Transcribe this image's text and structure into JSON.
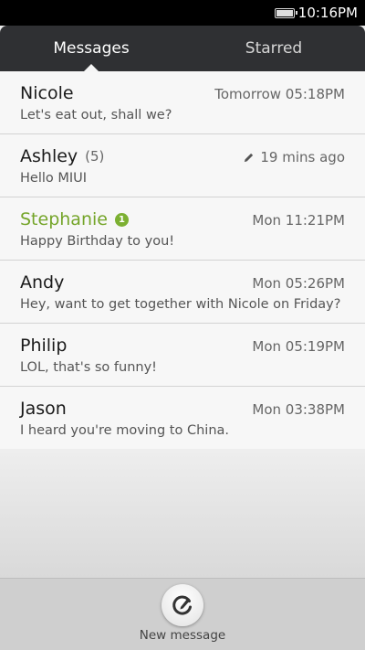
{
  "status_bar": {
    "time": "10:16PM",
    "battery_icon": "battery-icon",
    "battery_level": 1.0
  },
  "tabs": [
    {
      "label": "Messages",
      "active": true
    },
    {
      "label": "Starred",
      "active": false
    }
  ],
  "messages": [
    {
      "name": "Nicole",
      "count": "",
      "unread": "",
      "time": "Tomorrow 05:18PM",
      "snippet": "Let's eat out, shall we?",
      "draft": false
    },
    {
      "name": "Ashley",
      "count": "(5)",
      "unread": "",
      "time": "19 mins ago",
      "snippet": "Hello MIUI",
      "draft": true
    },
    {
      "name": "Stephanie",
      "count": "",
      "unread": "1",
      "time": "Mon 11:21PM",
      "snippet": "Happy Birthday to you!",
      "draft": false
    },
    {
      "name": "Andy",
      "count": "",
      "unread": "",
      "time": "Mon 05:26PM",
      "snippet": "Hey, want to get together with Nicole on Friday?",
      "draft": false
    },
    {
      "name": "Philip",
      "count": "",
      "unread": "",
      "time": "Mon 05:19PM",
      "snippet": "LOL, that's so funny!",
      "draft": false
    },
    {
      "name": "Jason",
      "count": "",
      "unread": "",
      "time": "Mon 03:38PM",
      "snippet": "I heard you're moving to China.",
      "draft": false
    }
  ],
  "bottom": {
    "compose_label": "New message",
    "compose_icon": "compose-icon"
  },
  "colors": {
    "accent_green": "#75a52a",
    "tab_bar": "#2f3033",
    "status_bar": "#000000"
  }
}
